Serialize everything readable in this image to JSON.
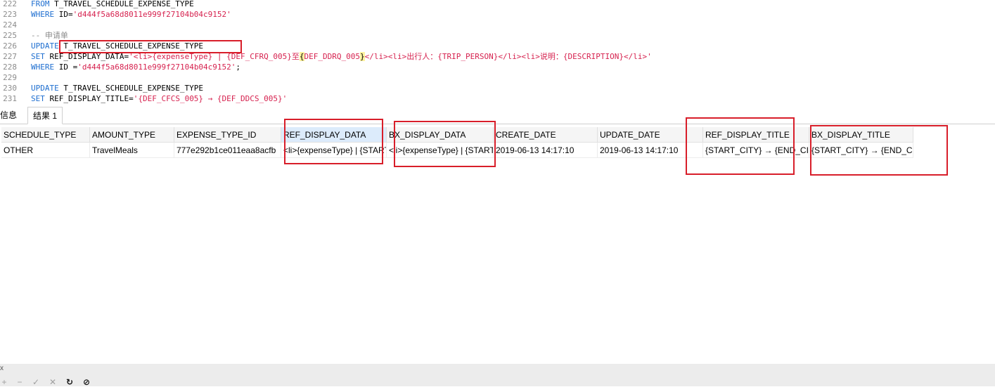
{
  "editor": {
    "lines": [
      {
        "num": "222",
        "segments": [
          {
            "t": "FROM ",
            "c": "kw"
          },
          {
            "t": "T_TRAVEL_SCHEDULE_EXPENSE_TYPE",
            "c": "plain"
          }
        ]
      },
      {
        "num": "223",
        "segments": [
          {
            "t": "WHERE ",
            "c": "kw"
          },
          {
            "t": "ID=",
            "c": "plain"
          },
          {
            "t": "'d444f5a68d8011e999f27104b04c9152'",
            "c": "str"
          }
        ]
      },
      {
        "num": "224",
        "segments": []
      },
      {
        "num": "225",
        "segments": [
          {
            "t": "-- 申请单",
            "c": "cmt"
          }
        ]
      },
      {
        "num": "226",
        "segments": [
          {
            "t": "UPDATE ",
            "c": "kw"
          },
          {
            "t": "T_TRAVEL_SCHEDULE_EXPENSE_TYPE",
            "c": "plain"
          }
        ]
      },
      {
        "num": "227",
        "segments": [
          {
            "t": "SET ",
            "c": "kw"
          },
          {
            "t": "REF_DISPLAY_DATA=",
            "c": "plain"
          },
          {
            "t": "'<li>{expenseType} | {DEF_CFRQ_005}至",
            "c": "str"
          },
          {
            "t": "{",
            "c": "hl"
          },
          {
            "t": "DEF_DDRQ_005",
            "c": "str"
          },
          {
            "t": "}",
            "c": "hl"
          },
          {
            "t": "</li><li>出行人：{TRIP_PERSON}</li><li>说明：{DESCRIPTION}</li>'",
            "c": "str"
          }
        ]
      },
      {
        "num": "228",
        "segments": [
          {
            "t": "WHERE ",
            "c": "kw"
          },
          {
            "t": "ID =",
            "c": "plain"
          },
          {
            "t": "'d444f5a68d8011e999f27104b04c9152'",
            "c": "str"
          },
          {
            "t": ";",
            "c": "plain"
          }
        ]
      },
      {
        "num": "229",
        "segments": []
      },
      {
        "num": "230",
        "segments": [
          {
            "t": "UPDATE ",
            "c": "kw"
          },
          {
            "t": "T_TRAVEL_SCHEDULE_EXPENSE_TYPE",
            "c": "plain"
          }
        ]
      },
      {
        "num": "231",
        "segments": [
          {
            "t": "SET ",
            "c": "kw"
          },
          {
            "t": "REF_DISPLAY_TITLE=",
            "c": "plain"
          },
          {
            "t": "'{DEF_CFCS_005} → {DEF_DDCS_005}'",
            "c": "str"
          }
        ]
      }
    ]
  },
  "tabs": {
    "info": "信息",
    "result": "结果 1"
  },
  "grid": {
    "columns": [
      "SCHEDULE_TYPE",
      "AMOUNT_TYPE",
      "EXPENSE_TYPE_ID",
      "REF_DISPLAY_DATA",
      "BX_DISPLAY_DATA",
      "CREATE_DATE",
      "UPDATE_DATE",
      "REF_DISPLAY_TITLE",
      "BX_DISPLAY_TITLE"
    ],
    "rows": [
      [
        "OTHER",
        "TravelMeals",
        "777e292b1ce011eaa8acfb",
        "<li>{expenseType} | {START",
        "<li>{expenseType} | {START",
        "2019-06-13 14:17:10",
        "2019-06-13 14:17:10",
        "{START_CITY} → {END_CITY}",
        "{START_CITY} → {END_CITY}"
      ]
    ]
  },
  "toolbar": {
    "tiny_mark": "x",
    "add": "+",
    "remove": "−",
    "apply": "✓",
    "discard": "✕",
    "refresh": "↻",
    "stop": "⊘"
  },
  "colors": {
    "keyword": "#1f6fd0",
    "string": "#d6224f",
    "annotation_red": "#d81e2a"
  }
}
